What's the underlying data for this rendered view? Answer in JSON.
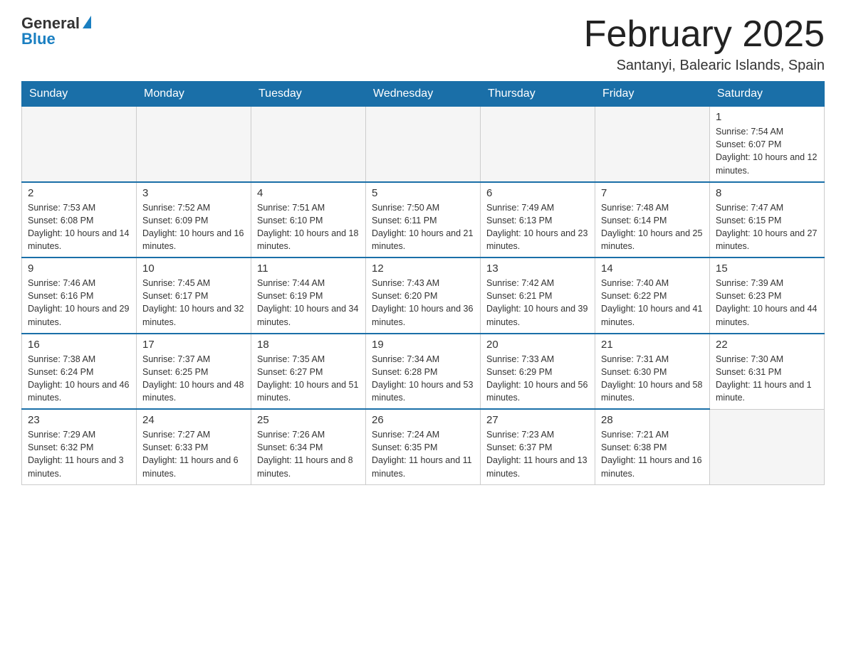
{
  "logo": {
    "general": "General",
    "blue": "Blue"
  },
  "header": {
    "month_title": "February 2025",
    "subtitle": "Santanyi, Balearic Islands, Spain"
  },
  "days_of_week": [
    "Sunday",
    "Monday",
    "Tuesday",
    "Wednesday",
    "Thursday",
    "Friday",
    "Saturday"
  ],
  "weeks": [
    [
      {
        "day": "",
        "info": ""
      },
      {
        "day": "",
        "info": ""
      },
      {
        "day": "",
        "info": ""
      },
      {
        "day": "",
        "info": ""
      },
      {
        "day": "",
        "info": ""
      },
      {
        "day": "",
        "info": ""
      },
      {
        "day": "1",
        "info": "Sunrise: 7:54 AM\nSunset: 6:07 PM\nDaylight: 10 hours and 12 minutes."
      }
    ],
    [
      {
        "day": "2",
        "info": "Sunrise: 7:53 AM\nSunset: 6:08 PM\nDaylight: 10 hours and 14 minutes."
      },
      {
        "day": "3",
        "info": "Sunrise: 7:52 AM\nSunset: 6:09 PM\nDaylight: 10 hours and 16 minutes."
      },
      {
        "day": "4",
        "info": "Sunrise: 7:51 AM\nSunset: 6:10 PM\nDaylight: 10 hours and 18 minutes."
      },
      {
        "day": "5",
        "info": "Sunrise: 7:50 AM\nSunset: 6:11 PM\nDaylight: 10 hours and 21 minutes."
      },
      {
        "day": "6",
        "info": "Sunrise: 7:49 AM\nSunset: 6:13 PM\nDaylight: 10 hours and 23 minutes."
      },
      {
        "day": "7",
        "info": "Sunrise: 7:48 AM\nSunset: 6:14 PM\nDaylight: 10 hours and 25 minutes."
      },
      {
        "day": "8",
        "info": "Sunrise: 7:47 AM\nSunset: 6:15 PM\nDaylight: 10 hours and 27 minutes."
      }
    ],
    [
      {
        "day": "9",
        "info": "Sunrise: 7:46 AM\nSunset: 6:16 PM\nDaylight: 10 hours and 29 minutes."
      },
      {
        "day": "10",
        "info": "Sunrise: 7:45 AM\nSunset: 6:17 PM\nDaylight: 10 hours and 32 minutes."
      },
      {
        "day": "11",
        "info": "Sunrise: 7:44 AM\nSunset: 6:19 PM\nDaylight: 10 hours and 34 minutes."
      },
      {
        "day": "12",
        "info": "Sunrise: 7:43 AM\nSunset: 6:20 PM\nDaylight: 10 hours and 36 minutes."
      },
      {
        "day": "13",
        "info": "Sunrise: 7:42 AM\nSunset: 6:21 PM\nDaylight: 10 hours and 39 minutes."
      },
      {
        "day": "14",
        "info": "Sunrise: 7:40 AM\nSunset: 6:22 PM\nDaylight: 10 hours and 41 minutes."
      },
      {
        "day": "15",
        "info": "Sunrise: 7:39 AM\nSunset: 6:23 PM\nDaylight: 10 hours and 44 minutes."
      }
    ],
    [
      {
        "day": "16",
        "info": "Sunrise: 7:38 AM\nSunset: 6:24 PM\nDaylight: 10 hours and 46 minutes."
      },
      {
        "day": "17",
        "info": "Sunrise: 7:37 AM\nSunset: 6:25 PM\nDaylight: 10 hours and 48 minutes."
      },
      {
        "day": "18",
        "info": "Sunrise: 7:35 AM\nSunset: 6:27 PM\nDaylight: 10 hours and 51 minutes."
      },
      {
        "day": "19",
        "info": "Sunrise: 7:34 AM\nSunset: 6:28 PM\nDaylight: 10 hours and 53 minutes."
      },
      {
        "day": "20",
        "info": "Sunrise: 7:33 AM\nSunset: 6:29 PM\nDaylight: 10 hours and 56 minutes."
      },
      {
        "day": "21",
        "info": "Sunrise: 7:31 AM\nSunset: 6:30 PM\nDaylight: 10 hours and 58 minutes."
      },
      {
        "day": "22",
        "info": "Sunrise: 7:30 AM\nSunset: 6:31 PM\nDaylight: 11 hours and 1 minute."
      }
    ],
    [
      {
        "day": "23",
        "info": "Sunrise: 7:29 AM\nSunset: 6:32 PM\nDaylight: 11 hours and 3 minutes."
      },
      {
        "day": "24",
        "info": "Sunrise: 7:27 AM\nSunset: 6:33 PM\nDaylight: 11 hours and 6 minutes."
      },
      {
        "day": "25",
        "info": "Sunrise: 7:26 AM\nSunset: 6:34 PM\nDaylight: 11 hours and 8 minutes."
      },
      {
        "day": "26",
        "info": "Sunrise: 7:24 AM\nSunset: 6:35 PM\nDaylight: 11 hours and 11 minutes."
      },
      {
        "day": "27",
        "info": "Sunrise: 7:23 AM\nSunset: 6:37 PM\nDaylight: 11 hours and 13 minutes."
      },
      {
        "day": "28",
        "info": "Sunrise: 7:21 AM\nSunset: 6:38 PM\nDaylight: 11 hours and 16 minutes."
      },
      {
        "day": "",
        "info": ""
      }
    ]
  ]
}
